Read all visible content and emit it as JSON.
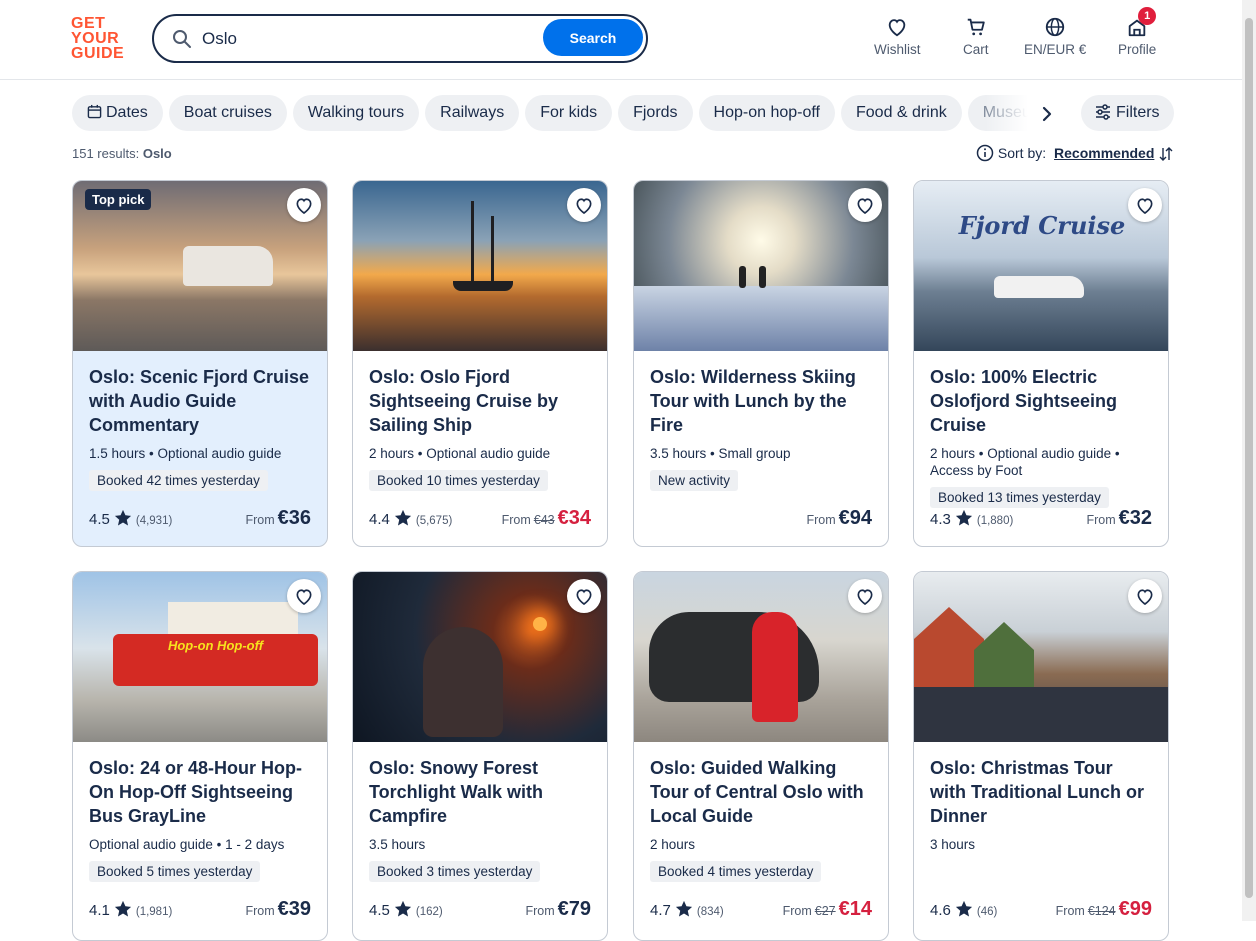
{
  "logo": {
    "line1": "GET",
    "line2": "YOUR",
    "line3": "GUIDE"
  },
  "search": {
    "value": "Oslo",
    "button": "Search"
  },
  "nav": {
    "wishlist": "Wishlist",
    "cart": "Cart",
    "locale": "EN/EUR €",
    "profile": "Profile",
    "profile_badge": "1"
  },
  "chips": [
    "Dates",
    "Boat cruises",
    "Walking tours",
    "Railways",
    "For kids",
    "Fjords",
    "Hop-on hop-off",
    "Food & drink",
    "Museums"
  ],
  "filters_label": "Filters",
  "results": {
    "count": "151 results:",
    "query": "Oslo"
  },
  "sort": {
    "label": "Sort by:",
    "value": "Recommended"
  },
  "colors": {
    "brand": "#ff5533",
    "accent": "#0071eb",
    "sale": "#d5203f",
    "text": "#1a2b49"
  },
  "cards": [
    {
      "badge": "Top pick",
      "title": "Oslo: Scenic Fjord Cruise with Audio Guide Commentary",
      "meta": "1.5 hours • Optional audio guide",
      "tag": "Booked 42 times yesterday",
      "rating": "4.5",
      "reviews": "(4,931)",
      "from": "From",
      "old_price": "",
      "price": "€36"
    },
    {
      "badge": "",
      "title": "Oslo: Oslo Fjord Sightseeing Cruise by Sailing Ship",
      "meta": "2 hours • Optional audio guide",
      "tag": "Booked 10 times yesterday",
      "rating": "4.4",
      "reviews": "(5,675)",
      "from": "From",
      "old_price": "€43",
      "price": "€34"
    },
    {
      "badge": "",
      "title": "Oslo: Wilderness Skiing Tour with Lunch by the Fire",
      "meta": "3.5 hours • Small group",
      "tag": "New activity",
      "rating": "",
      "reviews": "",
      "from": "From",
      "old_price": "",
      "price": "€94"
    },
    {
      "badge": "",
      "title": "Oslo: 100% Electric Oslofjord Sightseeing Cruise",
      "meta": "2 hours • Optional audio guide • Access by Foot",
      "tag": "Booked 13 times yesterday",
      "rating": "4.3",
      "reviews": "(1,880)",
      "from": "From",
      "old_price": "",
      "price": "€32",
      "image_text": "Fjord Cruise"
    },
    {
      "badge": "",
      "title": "Oslo: 24 or 48-Hour Hop-On Hop-Off Sightseeing Bus GrayLine",
      "meta": "Optional audio guide • 1 - 2 days",
      "tag": "Booked 5 times yesterday",
      "rating": "4.1",
      "reviews": "(1,981)",
      "from": "From",
      "old_price": "",
      "price": "€39",
      "image_text": "Hop-on Hop-off"
    },
    {
      "badge": "",
      "title": "Oslo: Snowy Forest Torchlight Walk with Campfire",
      "meta": "3.5 hours",
      "tag": "Booked 3 times yesterday",
      "rating": "4.5",
      "reviews": "(162)",
      "from": "From",
      "old_price": "",
      "price": "€79"
    },
    {
      "badge": "",
      "title": "Oslo: Guided Walking Tour of Central Oslo with Local Guide",
      "meta": "2 hours",
      "tag": "Booked 4 times yesterday",
      "rating": "4.7",
      "reviews": "(834)",
      "from": "From",
      "old_price": "€27",
      "price": "€14"
    },
    {
      "badge": "",
      "title": "Oslo: Christmas Tour with Traditional Lunch or Dinner",
      "meta": "3 hours",
      "tag": "",
      "rating": "4.6",
      "reviews": "(46)",
      "from": "From",
      "old_price": "€124",
      "price": "€99"
    }
  ]
}
